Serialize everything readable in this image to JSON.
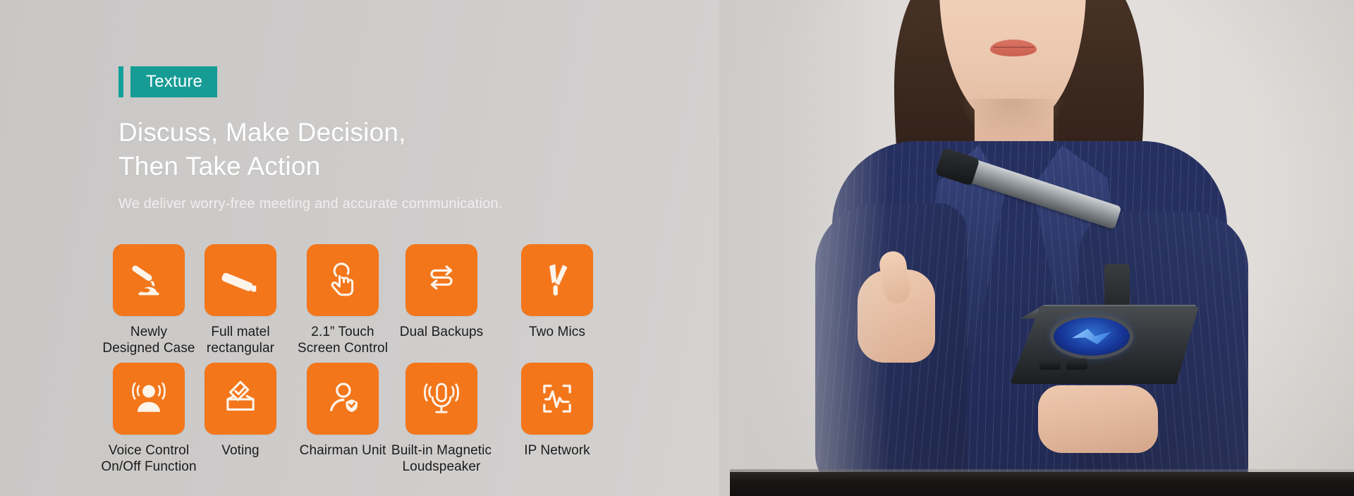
{
  "banner": {
    "badge_label": "Texture",
    "headline_line1": "Discuss, Make Decision,",
    "headline_line2": "Then Take Action",
    "subtitle": "We deliver worry-free meeting and accurate communication.",
    "accent_color": "#169c95",
    "accent_bar_color": "#12a09a",
    "tile_color": "#f3761b",
    "headline_color": "#ffffff",
    "caption_color": "#1b1b1b",
    "background_color": "#cdcbca"
  },
  "features": {
    "row1": [
      {
        "icon": "gooseneck-microphone-icon",
        "label": "Newly\nDesigned Case"
      },
      {
        "icon": "rectangular-bar-icon",
        "label": "Full matel\nrectangular"
      },
      {
        "icon": "touch-hand-icon",
        "label": "2.1” Touch\nScreen Control"
      },
      {
        "icon": "dual-arrows-backup-icon",
        "label": "Dual Backups"
      },
      {
        "icon": "two-microphones-icon",
        "label": "Two Mics"
      }
    ],
    "row2": [
      {
        "icon": "voice-control-person-icon",
        "label": "Voice Control\nOn/Off Function"
      },
      {
        "icon": "ballot-vote-box-icon",
        "label": "Voting"
      },
      {
        "icon": "chairman-person-badge-icon",
        "label": "Chairman Unit"
      },
      {
        "icon": "magnetic-loudspeaker-mic-icon",
        "label": "Built-in Magnetic\nLoudspeaker"
      },
      {
        "icon": "ip-network-waveform-icon",
        "label": "IP Network"
      }
    ]
  },
  "photo": {
    "alt_subject": "businesswoman-holding-conference-microphone-unit"
  }
}
